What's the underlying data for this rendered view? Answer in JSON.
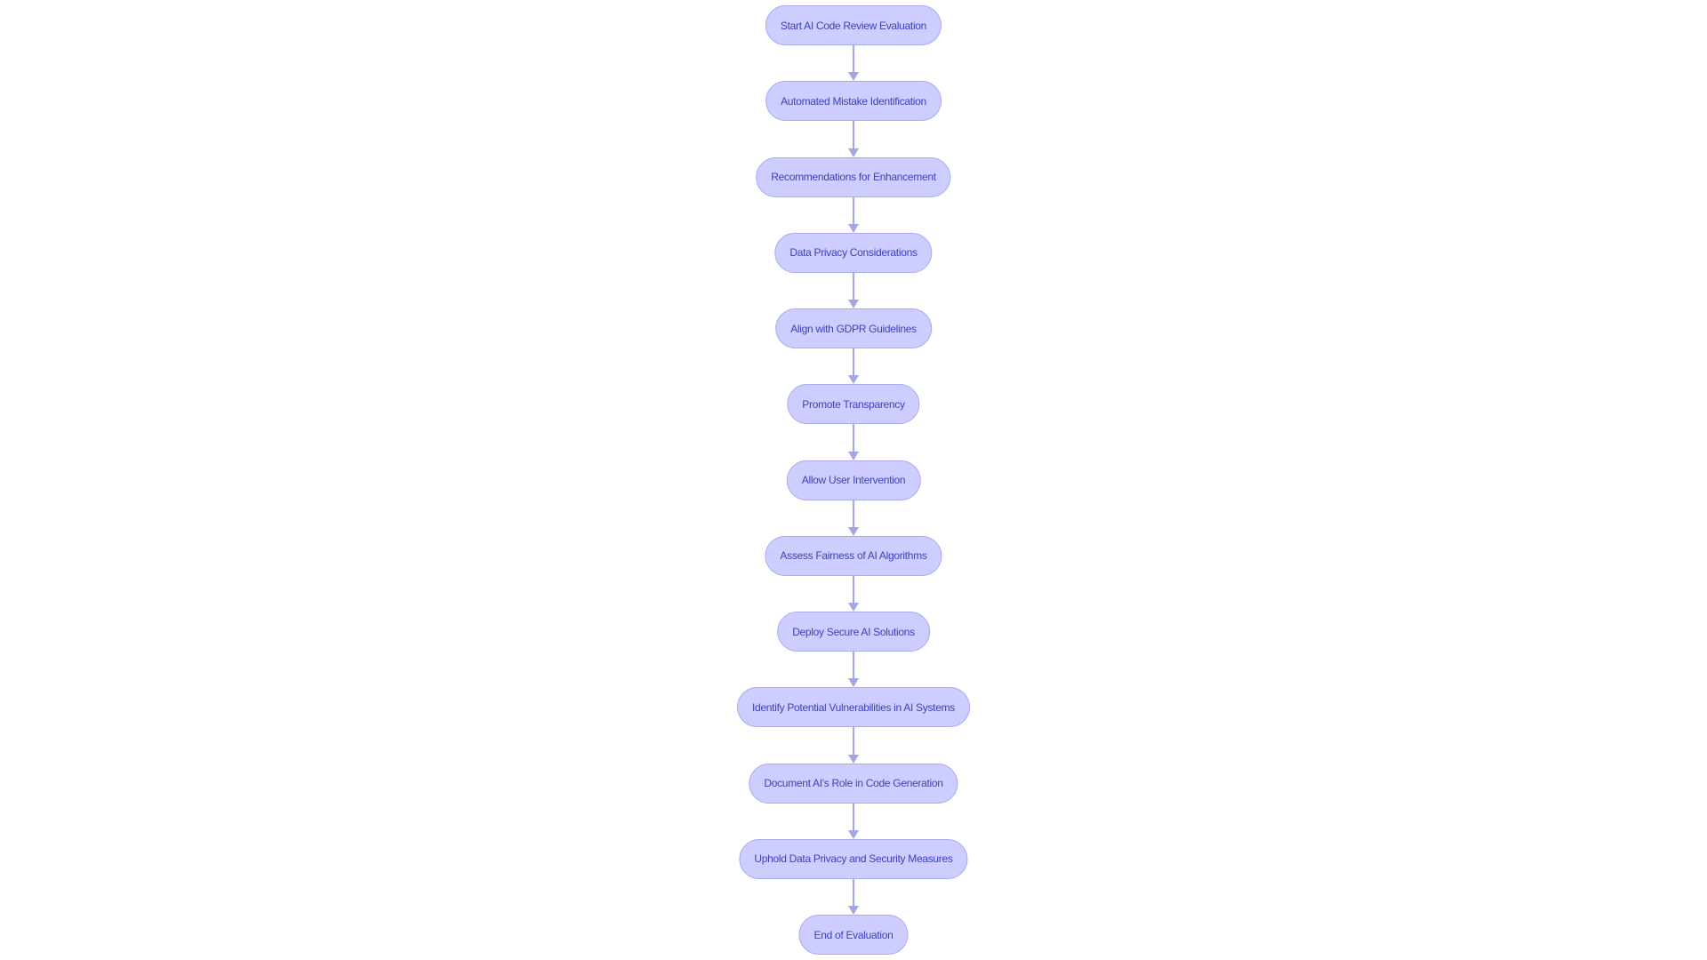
{
  "diagram": {
    "type": "flowchart",
    "direction": "top-to-bottom",
    "colors": {
      "node_fill": "#cdceff",
      "node_border": "#a9abf0",
      "node_text": "#3d41b8",
      "edge": "#a2a6e2",
      "background": "#ffffff"
    },
    "nodes": [
      {
        "id": "n1",
        "label": "Start AI Code Review Evaluation"
      },
      {
        "id": "n2",
        "label": "Automated Mistake Identification"
      },
      {
        "id": "n3",
        "label": "Recommendations for Enhancement"
      },
      {
        "id": "n4",
        "label": "Data Privacy Considerations"
      },
      {
        "id": "n5",
        "label": "Align with GDPR Guidelines"
      },
      {
        "id": "n6",
        "label": "Promote Transparency"
      },
      {
        "id": "n7",
        "label": "Allow User Intervention"
      },
      {
        "id": "n8",
        "label": "Assess Fairness of AI Algorithms"
      },
      {
        "id": "n9",
        "label": "Deploy Secure AI Solutions"
      },
      {
        "id": "n10",
        "label": "Identify Potential Vulnerabilities in AI Systems"
      },
      {
        "id": "n11",
        "label": "Document AI's Role in Code Generation"
      },
      {
        "id": "n12",
        "label": "Uphold Data Privacy and Security Measures"
      },
      {
        "id": "n13",
        "label": "End of Evaluation"
      }
    ],
    "edges": [
      {
        "from": "n1",
        "to": "n2"
      },
      {
        "from": "n2",
        "to": "n3"
      },
      {
        "from": "n3",
        "to": "n4"
      },
      {
        "from": "n4",
        "to": "n5"
      },
      {
        "from": "n5",
        "to": "n6"
      },
      {
        "from": "n6",
        "to": "n7"
      },
      {
        "from": "n7",
        "to": "n8"
      },
      {
        "from": "n8",
        "to": "n9"
      },
      {
        "from": "n9",
        "to": "n10"
      },
      {
        "from": "n10",
        "to": "n11"
      },
      {
        "from": "n11",
        "to": "n12"
      },
      {
        "from": "n12",
        "to": "n13"
      }
    ]
  }
}
